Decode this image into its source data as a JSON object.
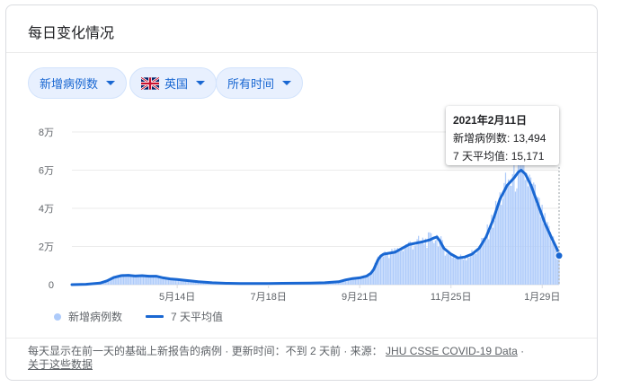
{
  "card_title": "每日变化情况",
  "filters": {
    "metric_label": "新增病例数",
    "region_label": "英国",
    "time_label": "所有时间"
  },
  "legend": {
    "bars_label": "新增病例数",
    "line_label": "7 天平均值"
  },
  "tooltip": {
    "date": "2021年2月11日",
    "cases_label": "新增病例数:",
    "cases_value": "13,494",
    "avg_label": "7 天平均值:",
    "avg_value": "15,171"
  },
  "footer": {
    "text": "每天显示在前一天的基础上新报告的病例 · 更新时间：不到 2 天前 · 来源：",
    "source_link": "JHU CSSE COVID-19 Data",
    "about_link": "关于这些数据"
  },
  "colors": {
    "bar": "#aecbfa",
    "line": "#1967d2",
    "accent_chip": "#e8f0fe"
  },
  "chart_data": {
    "type": "bar",
    "x_range_days": [
      0,
      347
    ],
    "x_ticks": [
      {
        "day": 75,
        "label": "5月14日"
      },
      {
        "day": 140,
        "label": "7月18日"
      },
      {
        "day": 205,
        "label": "9月21日"
      },
      {
        "day": 270,
        "label": "11月25日"
      },
      {
        "day": 335,
        "label": "1月29日"
      }
    ],
    "y_ticks": [
      {
        "value": 0,
        "label": "0"
      },
      {
        "value": 20000,
        "label": "2万"
      },
      {
        "value": 40000,
        "label": "4万"
      },
      {
        "value": 60000,
        "label": "6万"
      },
      {
        "value": 80000,
        "label": "8万"
      }
    ],
    "ylim": [
      0,
      80000
    ],
    "series": [
      {
        "name": "7 天平均值",
        "kind": "line",
        "points": [
          [
            0,
            0
          ],
          [
            10,
            200
          ],
          [
            20,
            800
          ],
          [
            25,
            2000
          ],
          [
            30,
            3800
          ],
          [
            35,
            4700
          ],
          [
            40,
            4900
          ],
          [
            45,
            4500
          ],
          [
            50,
            4700
          ],
          [
            55,
            4400
          ],
          [
            60,
            4400
          ],
          [
            65,
            3600
          ],
          [
            70,
            3000
          ],
          [
            75,
            2700
          ],
          [
            80,
            2300
          ],
          [
            90,
            1500
          ],
          [
            100,
            1000
          ],
          [
            110,
            700
          ],
          [
            120,
            600
          ],
          [
            130,
            600
          ],
          [
            140,
            600
          ],
          [
            150,
            700
          ],
          [
            160,
            750
          ],
          [
            170,
            800
          ],
          [
            180,
            1000
          ],
          [
            190,
            1500
          ],
          [
            195,
            2500
          ],
          [
            200,
            3200
          ],
          [
            205,
            3600
          ],
          [
            210,
            4500
          ],
          [
            213,
            6000
          ],
          [
            215,
            8000
          ],
          [
            218,
            13000
          ],
          [
            220,
            15000
          ],
          [
            222,
            16000
          ],
          [
            230,
            17000
          ],
          [
            240,
            21000
          ],
          [
            250,
            22500
          ],
          [
            255,
            23500
          ],
          [
            258,
            24500
          ],
          [
            260,
            25000
          ],
          [
            262,
            23000
          ],
          [
            265,
            19000
          ],
          [
            270,
            16000
          ],
          [
            275,
            14000
          ],
          [
            280,
            14500
          ],
          [
            285,
            16000
          ],
          [
            290,
            19000
          ],
          [
            295,
            25000
          ],
          [
            300,
            34000
          ],
          [
            305,
            45000
          ],
          [
            310,
            52000
          ],
          [
            315,
            56000
          ],
          [
            318,
            59000
          ],
          [
            320,
            60000
          ],
          [
            323,
            58000
          ],
          [
            327,
            52000
          ],
          [
            332,
            42000
          ],
          [
            337,
            32000
          ],
          [
            342,
            24000
          ],
          [
            346,
            18000
          ],
          [
            347,
            15171
          ]
        ]
      },
      {
        "name": "新增病例数",
        "kind": "bars",
        "derived_from": "7 天平均值",
        "noise": 0.18
      }
    ],
    "hover_day": 347
  }
}
